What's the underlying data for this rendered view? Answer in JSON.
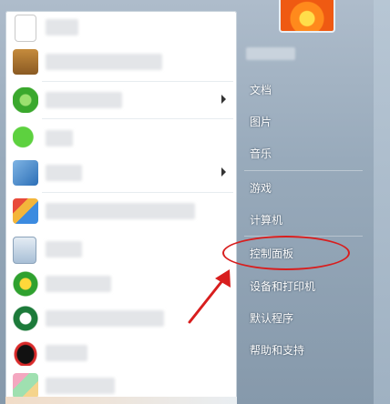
{
  "right_menu": {
    "items": [
      "文档",
      "图片",
      "音乐",
      "游戏",
      "计算机",
      "控制面板",
      "设备和打印机",
      "默认程序",
      "帮助和支持"
    ]
  },
  "annotation": {
    "highlighted_item": "控制面板",
    "color": "#d81e1e"
  },
  "programs": [
    {
      "icon": "blank-document-icon",
      "has_submenu": false
    },
    {
      "icon": "recycle-icon",
      "has_submenu": false
    },
    {
      "icon": "ie-browser-icon",
      "has_submenu": true
    },
    {
      "icon": "wechat-icon",
      "has_submenu": false
    },
    {
      "icon": "document-app-icon",
      "has_submenu": true
    },
    {
      "icon": "paint-app-icon",
      "has_submenu": false
    },
    {
      "icon": "notepad-icon",
      "has_submenu": false
    },
    {
      "icon": "green-plus-icon",
      "has_submenu": false
    },
    {
      "icon": "green-circle-app-icon",
      "has_submenu": false
    },
    {
      "icon": "qq-penguin-icon",
      "has_submenu": false
    }
  ]
}
